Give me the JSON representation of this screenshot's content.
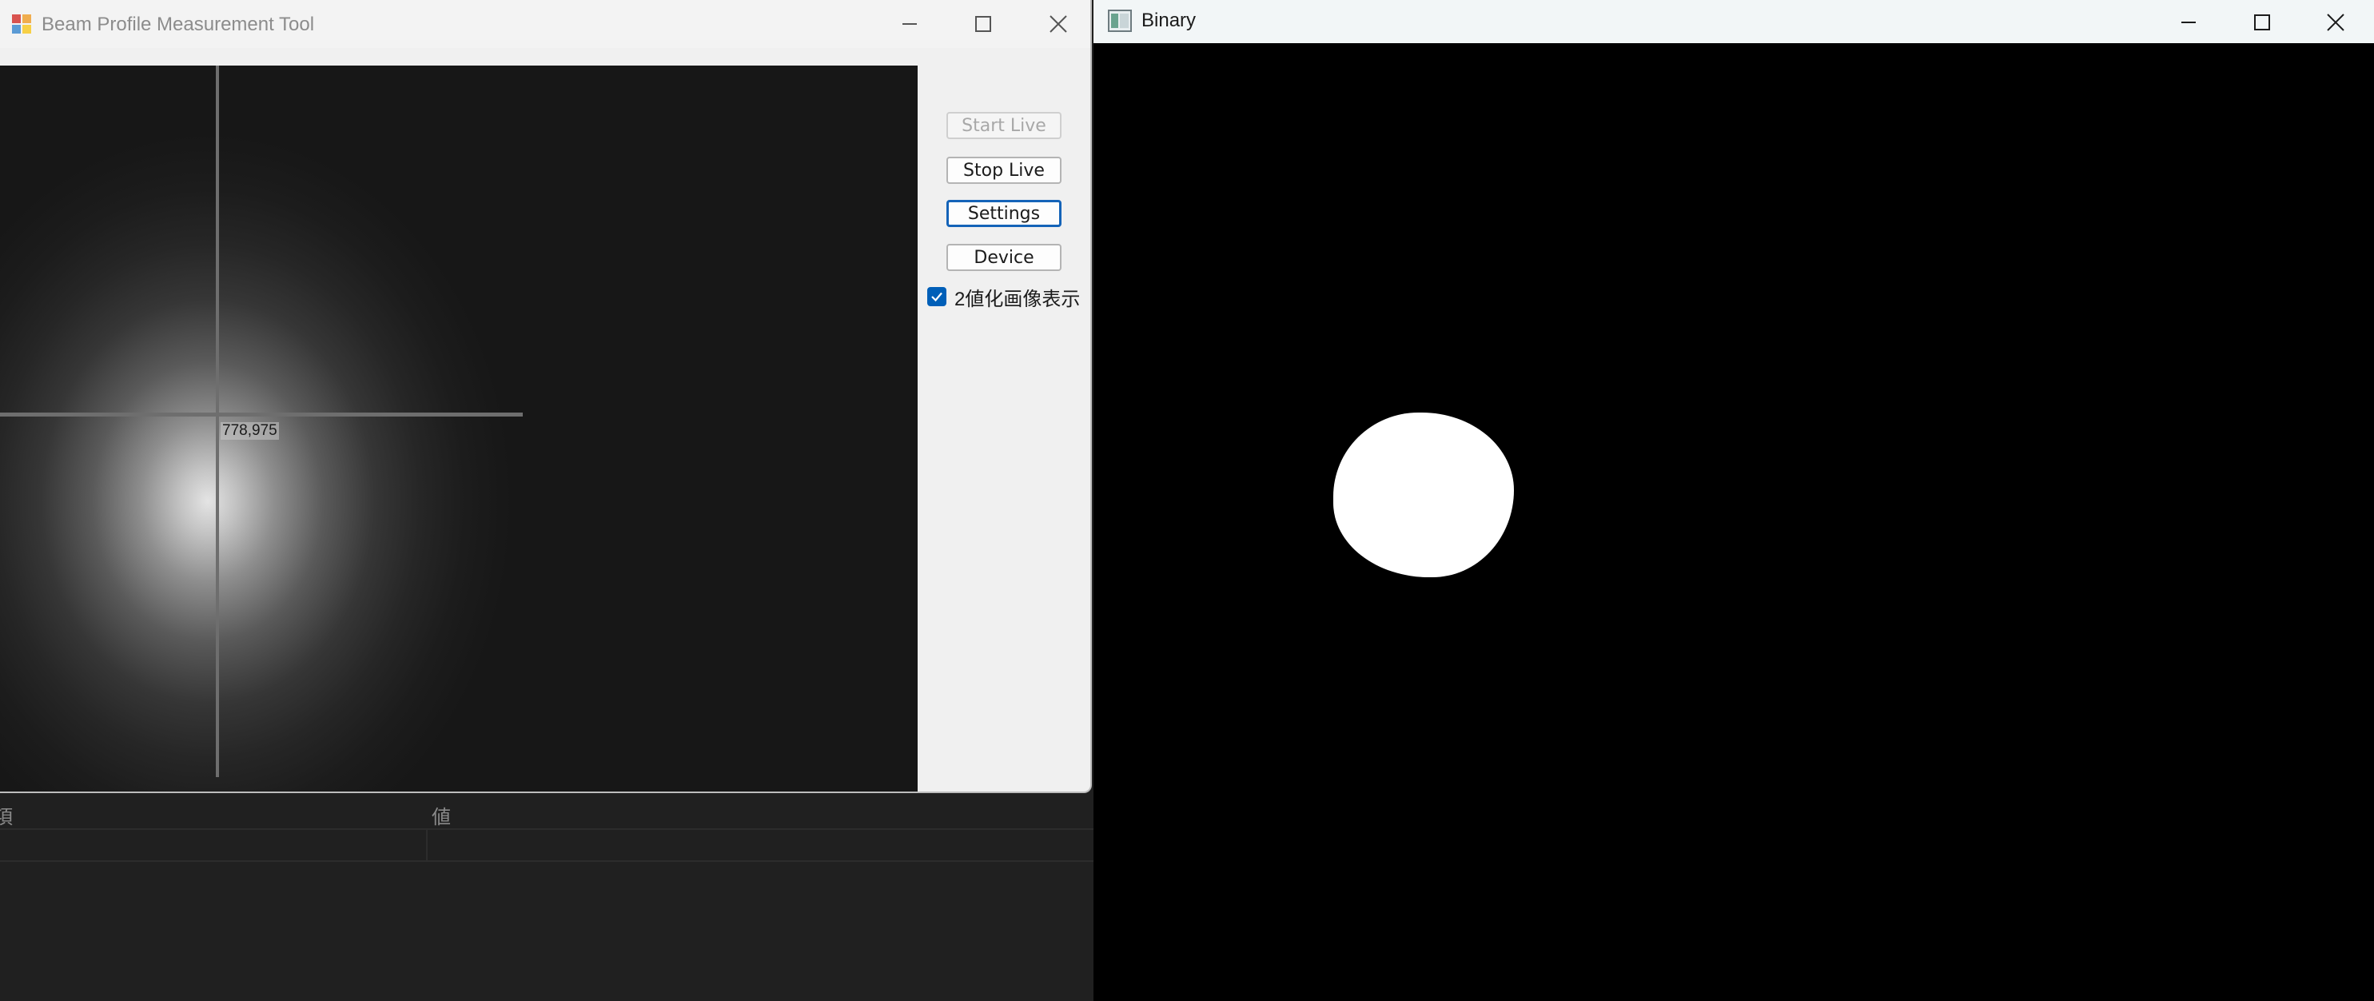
{
  "main_window": {
    "title": "Beam Profile Measurement Tool",
    "crosshair_coord": "778,975",
    "buttons": {
      "start_live": "Start Live",
      "stop_live": "Stop Live",
      "settings": "Settings",
      "device": "Device"
    },
    "binary_checkbox": {
      "label": "2値化画像表示",
      "checked": true
    }
  },
  "binary_window": {
    "title": "Binary"
  },
  "background_panel": {
    "headers": [
      "項",
      "値"
    ]
  },
  "colors": {
    "accent": "#005fb8",
    "focus_border": "#1463b8"
  }
}
